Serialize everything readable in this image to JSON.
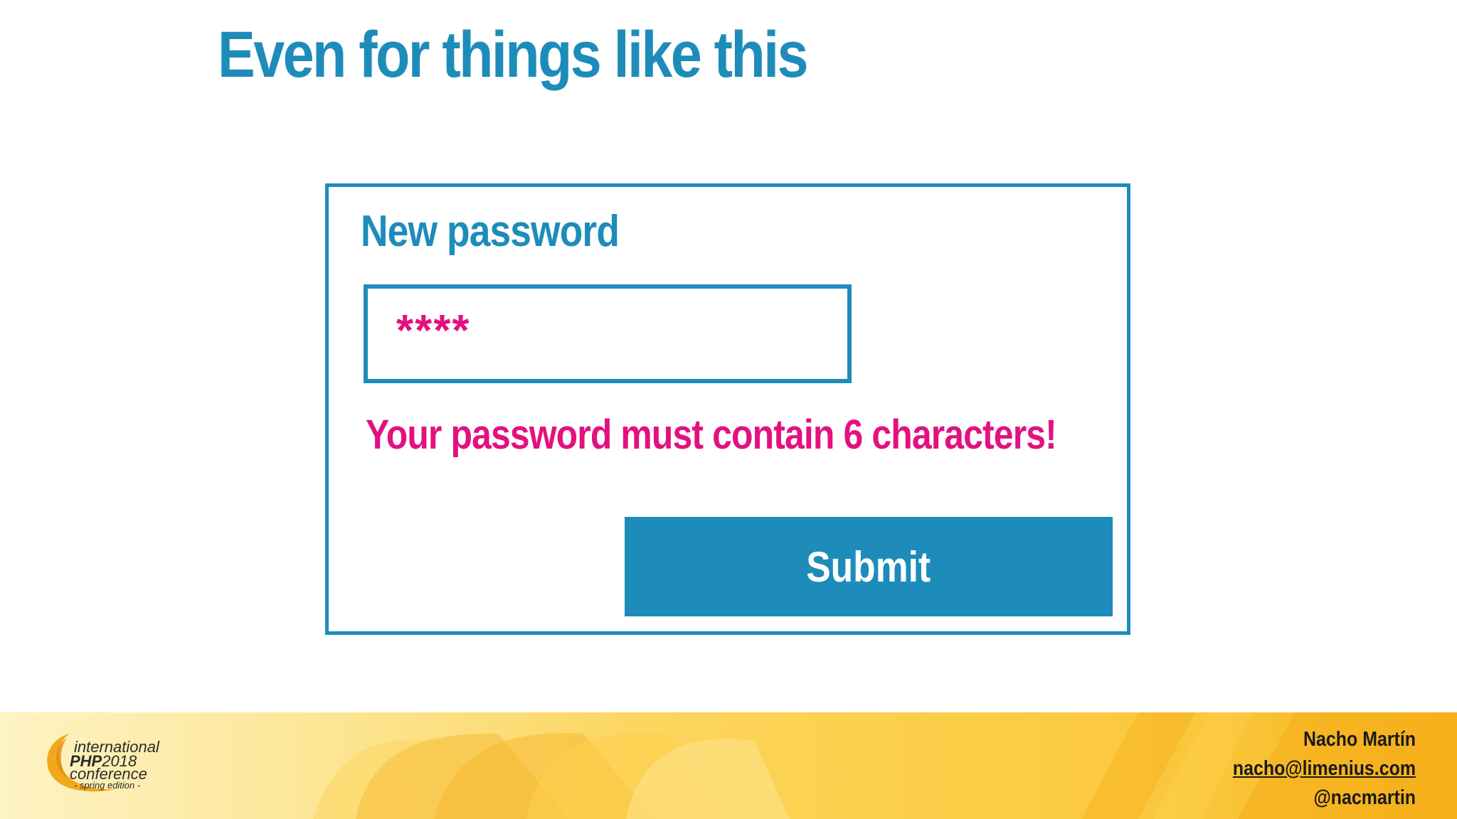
{
  "slide": {
    "title": "Even for things like this"
  },
  "form": {
    "label": "New password",
    "password_value": "****",
    "error_message": "Your password must contain 6 characters!",
    "submit_label": "Submit"
  },
  "footer": {
    "logo": {
      "line1": "international",
      "brand": "PHP",
      "year": "2018",
      "line3": "conference",
      "line4": "- spring edition -"
    },
    "speaker": {
      "name": "Nacho Martín",
      "email": "nacho@limenius.com",
      "handle": "@nacmartin"
    }
  },
  "colors": {
    "accent_blue": "#1e8cba",
    "error_pink": "#e3117f",
    "footer_yellow": "#fbd04c"
  },
  "icons": {
    "logo_swoosh": "swoosh-icon"
  }
}
